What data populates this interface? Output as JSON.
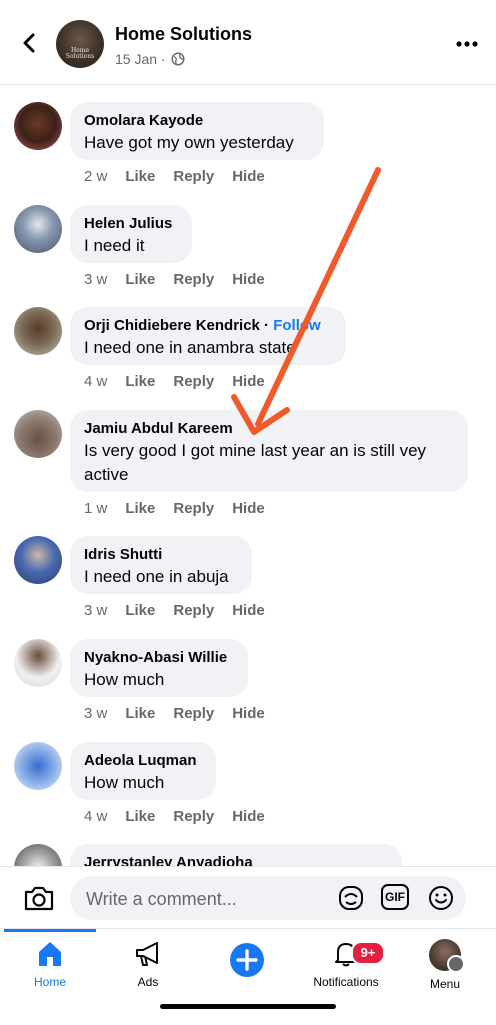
{
  "header": {
    "title": "Home Solutions",
    "date": "15 Jan · ",
    "logo_text": "Home Solutions"
  },
  "comments": [
    {
      "author": "Omolara Kayode",
      "text": "Have got my own yesterday",
      "time": "2 w",
      "like": "Like",
      "reply": "Reply",
      "hide": "Hide"
    },
    {
      "author": "Helen Julius",
      "text": "I need it",
      "time": "3 w",
      "like": "Like",
      "reply": "Reply",
      "hide": "Hide"
    },
    {
      "author": "Orji Chidiebere Kendrick",
      "follow": "Follow",
      "text": "I need one in anambra state",
      "time": "4 w",
      "like": "Like",
      "reply": "Reply",
      "hide": "Hide"
    },
    {
      "author": "Jamiu Abdul Kareem",
      "text_line1": "Is very good I got mine last year an is still vey",
      "text_line2": "active",
      "time": "1 w",
      "like": "Like",
      "reply": "Reply",
      "hide": "Hide"
    },
    {
      "author": "Idris Shutti",
      "text": "I need one in abuja",
      "time": "3 w",
      "like": "Like",
      "reply": "Reply",
      "hide": "Hide"
    },
    {
      "author": "Nyakno-Abasi Willie",
      "text": "How much",
      "time": "3 w",
      "like": "Like",
      "reply": "Reply",
      "hide": "Hide"
    },
    {
      "author": "Adeola Luqman",
      "text": "How much",
      "time": "4 w",
      "like": "Like",
      "reply": "Reply",
      "hide": "Hide"
    },
    {
      "author": "Jerrystanley Anyadioha"
    }
  ],
  "composer": {
    "placeholder": "Write a comment...",
    "gif_label": "GIF"
  },
  "tabs": [
    {
      "label": "Home",
      "icon": "home-icon",
      "active": true
    },
    {
      "label": "Ads",
      "icon": "megaphone-icon"
    },
    {
      "label": "",
      "icon": "plus-circle-icon"
    },
    {
      "label": "Notifications",
      "icon": "bell-icon",
      "badge": "9+"
    },
    {
      "label": "Menu",
      "icon": "profile-menu-icon"
    }
  ],
  "colors": {
    "accent": "#1877f2",
    "bubble": "#f0f2f5",
    "secondary_text": "#65676b",
    "badge": "#e41e3f",
    "annotation_arrow": "#f05a2a"
  }
}
